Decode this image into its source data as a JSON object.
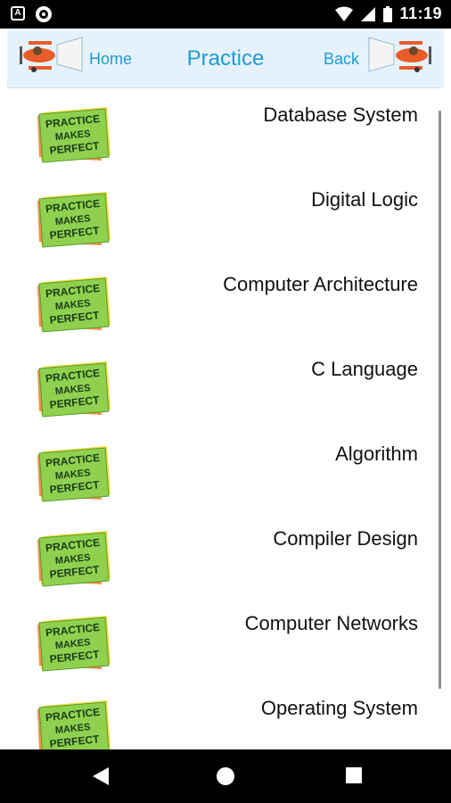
{
  "status_bar": {
    "time": "11:19"
  },
  "header": {
    "home_label": "Home",
    "title": "Practice",
    "back_label": "Back"
  },
  "list": {
    "image_text": [
      "PRACTICE",
      "MAKES",
      "PERFECT"
    ],
    "items": [
      {
        "label": "Database System"
      },
      {
        "label": "Digital Logic"
      },
      {
        "label": "Computer Architecture"
      },
      {
        "label": "C Language"
      },
      {
        "label": "Algorithm"
      },
      {
        "label": "Compiler Design"
      },
      {
        "label": "Computer Networks"
      },
      {
        "label": "Operating System"
      }
    ]
  },
  "colors": {
    "accent": "#1e9ad6",
    "header_bg": "#e6f2fb",
    "sticky_green": "#8fd14f",
    "sticky_yellow": "#f4dc3c"
  }
}
